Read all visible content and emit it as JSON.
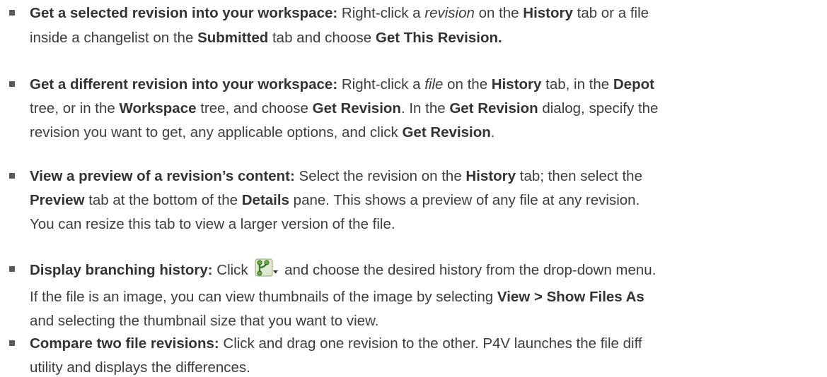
{
  "items": [
    {
      "lines": [
        [
          {
            "t": "Get a selected revision into your workspace:",
            "s": "b"
          },
          {
            "t": " Right-click a ",
            "s": ""
          },
          {
            "t": "revision",
            "s": "i"
          },
          {
            "t": " on the ",
            "s": ""
          },
          {
            "t": "History",
            "s": "b"
          },
          {
            "t": " tab or a file",
            "s": ""
          }
        ],
        [
          {
            "t": "inside a changelist on the ",
            "s": ""
          },
          {
            "t": "Submitted",
            "s": "b"
          },
          {
            "t": " tab and choose ",
            "s": ""
          },
          {
            "t": "Get This Revision.",
            "s": "b"
          }
        ]
      ]
    },
    {
      "lines": [
        [
          {
            "t": "Get a different revision into your workspace:",
            "s": "b"
          },
          {
            "t": " Right-click a ",
            "s": ""
          },
          {
            "t": "file",
            "s": "i"
          },
          {
            "t": " on the ",
            "s": ""
          },
          {
            "t": "History",
            "s": "b"
          },
          {
            "t": " tab, in the ",
            "s": ""
          },
          {
            "t": "Depot",
            "s": "b"
          }
        ],
        [
          {
            "t": "tree, or in the ",
            "s": ""
          },
          {
            "t": "Workspace",
            "s": "b"
          },
          {
            "t": " tree, and choose ",
            "s": ""
          },
          {
            "t": "Get Revision",
            "s": "b"
          },
          {
            "t": ". In the ",
            "s": ""
          },
          {
            "t": "Get Revision",
            "s": "b"
          },
          {
            "t": " dialog, specify the",
            "s": ""
          }
        ],
        [
          {
            "t": "revision you want to get, any applicable options, and click ",
            "s": ""
          },
          {
            "t": "Get Revision",
            "s": "b"
          },
          {
            "t": ".",
            "s": ""
          }
        ]
      ]
    },
    {
      "lines": [
        [
          {
            "t": "View a preview of a revision’s content:",
            "s": "b"
          },
          {
            "t": " Select the revision on the ",
            "s": ""
          },
          {
            "t": "History",
            "s": "b"
          },
          {
            "t": " tab; then select the",
            "s": ""
          }
        ],
        [
          {
            "t": "Preview",
            "s": "b"
          },
          {
            "t": " tab at the bottom of the ",
            "s": ""
          },
          {
            "t": "Details",
            "s": "b"
          },
          {
            "t": " pane. This shows a preview of any file at any revision.",
            "s": ""
          }
        ],
        [
          {
            "t": "You can resize this tab to view a larger version of the file.",
            "s": ""
          }
        ]
      ]
    },
    {
      "lines": [
        [
          {
            "t": "Display branching history:",
            "s": "b"
          },
          {
            "t": " Click ",
            "s": ""
          },
          {
            "icon": "branching-history-icon"
          },
          {
            "t": " and choose the desired history from the drop-down menu.",
            "s": ""
          }
        ]
      ],
      "note": [
        [
          {
            "t": "If the file is an image, you can view thumbnails of the image by selecting ",
            "s": ""
          },
          {
            "t": "View > Show Files As",
            "s": "b"
          }
        ],
        [
          {
            "t": "and selecting the thumbnail size that you want to view.",
            "s": ""
          }
        ]
      ]
    },
    {
      "lines": [
        [
          {
            "t": "Compare two file revisions:",
            "s": "b"
          },
          {
            "t": " Click and drag one revision to the other. P4V launches the file diff",
            "s": ""
          }
        ],
        [
          {
            "t": "utility and displays the differences.",
            "s": ""
          }
        ]
      ]
    }
  ]
}
